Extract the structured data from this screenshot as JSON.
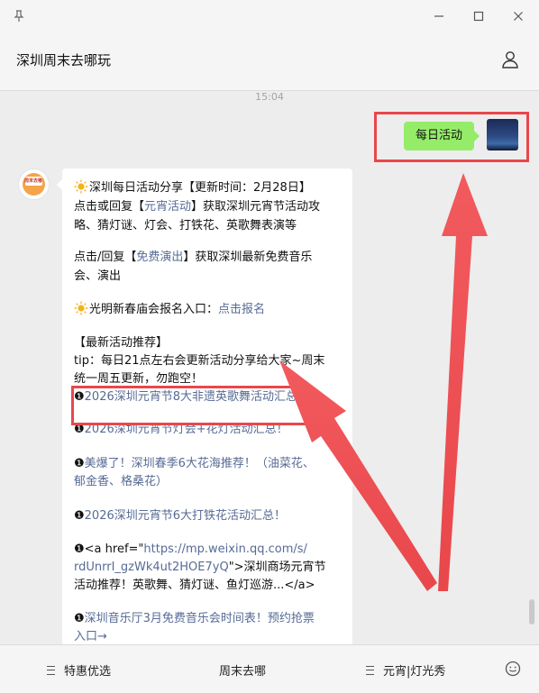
{
  "window": {
    "pin_icon": "pin-icon",
    "minimize_icon": "minimize-icon",
    "maximize_icon": "maximize-icon",
    "close_icon": "close-icon"
  },
  "header": {
    "title": "深圳周末去哪玩",
    "profile_icon": "person-icon"
  },
  "chat": {
    "time": "15:04",
    "my_message": "每日活动",
    "my_avatar": "night-sky-photo",
    "bot_avatar_text": "周末去哪",
    "bot_avatar_subtext": "深圳",
    "reply": {
      "l1": "深圳每日活动分享【更新时间：2月28日】",
      "l2a": "点击或回复【",
      "l2b": "元宵活动",
      "l2c": "】获取深圳元宵节活动攻",
      "l3": "略、猜灯谜、灯会、打铁花、英歌舞表演等",
      "l4a": "点击/回复【",
      "l4b": "免费演出",
      "l4c": "】获取深圳最新免费音乐",
      "l5": "会、演出",
      "l6a": "光明新春庙会报名入口：",
      "l6b": "点击报名",
      "l7": "【最新活动推荐】",
      "l8": "tip：每日21点左右会更新活动分享给大家~周末",
      "l9": "统一周五更新，勿跑空！",
      "n1": "2026深圳元宵节8大非遗英歌舞活动汇总！",
      "n2": "2026深圳元宵节灯会+花灯活动汇总！",
      "n3a": "美爆了！深圳春季6大花海推荐！（油菜花、",
      "n3b": "郁金香、格桑花）",
      "n4": "2026深圳元宵节6大打铁花活动汇总！",
      "h1a": "<a href=\"",
      "h1b": "https://mp.weixin.qq.com/s/",
      "h2a": "rdUnrrI_gzWk4ut2HOE7yQ",
      "h2b": "\">深圳商场元宵节",
      "h3": "活动推荐！英歌舞、猜灯谜、鱼灯巡游...</a>",
      "n5a": "深圳音乐厅3月免费音乐会时间表！预约抢票",
      "n5b": "入口→"
    }
  },
  "footer": {
    "menu1": "特惠优选",
    "menu2": "周末去哪",
    "menu3": "元宵|灯光秀",
    "emoji_icon": "emoji-icon"
  },
  "colors": {
    "link": "#576b95",
    "bubble_green": "#95ec69",
    "annotation_red": "#e8474b",
    "background": "#ededed"
  }
}
